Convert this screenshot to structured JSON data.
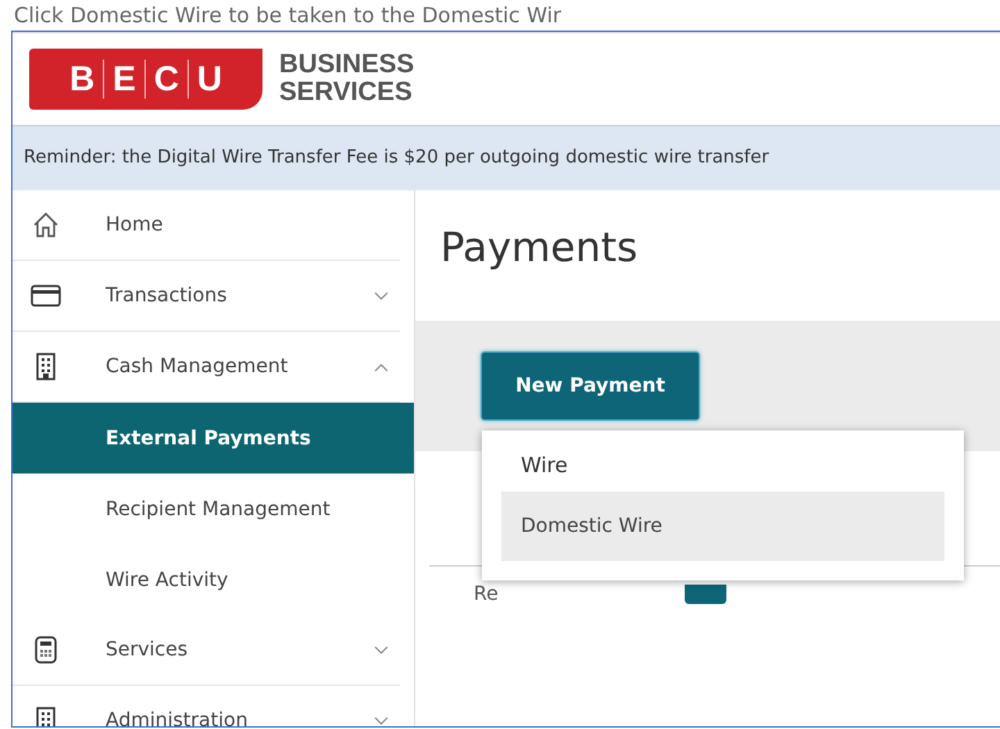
{
  "caption": "Click Domestic Wire to be taken to the Domestic Wir",
  "header": {
    "logo_letters": [
      "B",
      "E",
      "C",
      "U"
    ],
    "logo_text": [
      "BUSINESS",
      "SERVICES"
    ]
  },
  "reminder": "Reminder: the Digital Wire Transfer Fee is $20 per outgoing domestic wire transfer",
  "sidebar": {
    "items": [
      {
        "label": "Home",
        "selected": false
      },
      {
        "label": "Transactions",
        "selected": false,
        "expanded": false
      },
      {
        "label": "Cash Management",
        "selected": false,
        "expanded": true,
        "children": [
          {
            "label": "External Payments",
            "selected": true
          },
          {
            "label": "Recipient Management",
            "selected": false
          },
          {
            "label": "Wire Activity",
            "selected": false
          }
        ]
      },
      {
        "label": "Services",
        "selected": false,
        "expanded": false
      },
      {
        "label": "Administration",
        "selected": false,
        "expanded": false
      }
    ]
  },
  "main": {
    "title": "Payments",
    "new_payment_button": "New Payment",
    "menu": {
      "header": "Wire",
      "items": [
        {
          "label": "Domestic Wire",
          "selected": true
        }
      ]
    },
    "results_label": "Re"
  }
}
